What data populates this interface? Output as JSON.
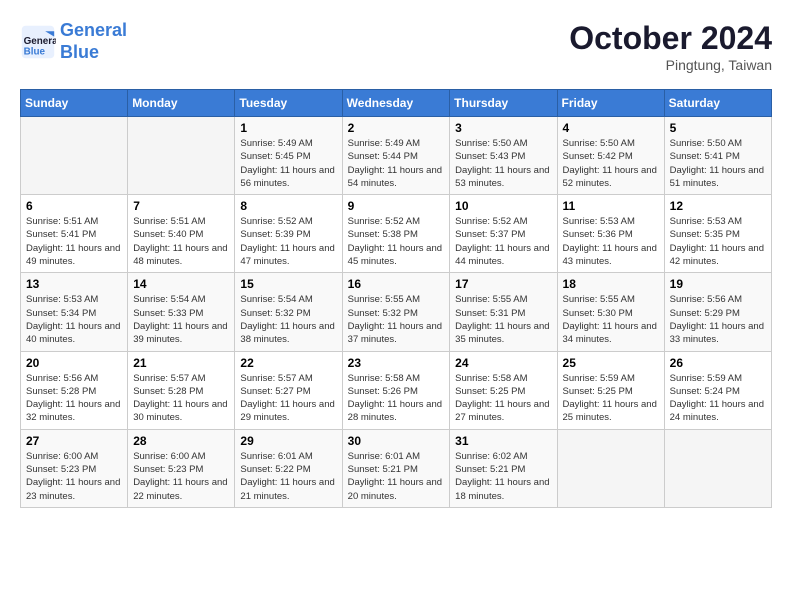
{
  "header": {
    "logo_line1": "General",
    "logo_line2": "Blue",
    "month": "October 2024",
    "location": "Pingtung, Taiwan"
  },
  "weekdays": [
    "Sunday",
    "Monday",
    "Tuesday",
    "Wednesday",
    "Thursday",
    "Friday",
    "Saturday"
  ],
  "weeks": [
    [
      {
        "day": "",
        "sunrise": "",
        "sunset": "",
        "daylight": ""
      },
      {
        "day": "",
        "sunrise": "",
        "sunset": "",
        "daylight": ""
      },
      {
        "day": "1",
        "sunrise": "Sunrise: 5:49 AM",
        "sunset": "Sunset: 5:45 PM",
        "daylight": "Daylight: 11 hours and 56 minutes."
      },
      {
        "day": "2",
        "sunrise": "Sunrise: 5:49 AM",
        "sunset": "Sunset: 5:44 PM",
        "daylight": "Daylight: 11 hours and 54 minutes."
      },
      {
        "day": "3",
        "sunrise": "Sunrise: 5:50 AM",
        "sunset": "Sunset: 5:43 PM",
        "daylight": "Daylight: 11 hours and 53 minutes."
      },
      {
        "day": "4",
        "sunrise": "Sunrise: 5:50 AM",
        "sunset": "Sunset: 5:42 PM",
        "daylight": "Daylight: 11 hours and 52 minutes."
      },
      {
        "day": "5",
        "sunrise": "Sunrise: 5:50 AM",
        "sunset": "Sunset: 5:41 PM",
        "daylight": "Daylight: 11 hours and 51 minutes."
      }
    ],
    [
      {
        "day": "6",
        "sunrise": "Sunrise: 5:51 AM",
        "sunset": "Sunset: 5:41 PM",
        "daylight": "Daylight: 11 hours and 49 minutes."
      },
      {
        "day": "7",
        "sunrise": "Sunrise: 5:51 AM",
        "sunset": "Sunset: 5:40 PM",
        "daylight": "Daylight: 11 hours and 48 minutes."
      },
      {
        "day": "8",
        "sunrise": "Sunrise: 5:52 AM",
        "sunset": "Sunset: 5:39 PM",
        "daylight": "Daylight: 11 hours and 47 minutes."
      },
      {
        "day": "9",
        "sunrise": "Sunrise: 5:52 AM",
        "sunset": "Sunset: 5:38 PM",
        "daylight": "Daylight: 11 hours and 45 minutes."
      },
      {
        "day": "10",
        "sunrise": "Sunrise: 5:52 AM",
        "sunset": "Sunset: 5:37 PM",
        "daylight": "Daylight: 11 hours and 44 minutes."
      },
      {
        "day": "11",
        "sunrise": "Sunrise: 5:53 AM",
        "sunset": "Sunset: 5:36 PM",
        "daylight": "Daylight: 11 hours and 43 minutes."
      },
      {
        "day": "12",
        "sunrise": "Sunrise: 5:53 AM",
        "sunset": "Sunset: 5:35 PM",
        "daylight": "Daylight: 11 hours and 42 minutes."
      }
    ],
    [
      {
        "day": "13",
        "sunrise": "Sunrise: 5:53 AM",
        "sunset": "Sunset: 5:34 PM",
        "daylight": "Daylight: 11 hours and 40 minutes."
      },
      {
        "day": "14",
        "sunrise": "Sunrise: 5:54 AM",
        "sunset": "Sunset: 5:33 PM",
        "daylight": "Daylight: 11 hours and 39 minutes."
      },
      {
        "day": "15",
        "sunrise": "Sunrise: 5:54 AM",
        "sunset": "Sunset: 5:32 PM",
        "daylight": "Daylight: 11 hours and 38 minutes."
      },
      {
        "day": "16",
        "sunrise": "Sunrise: 5:55 AM",
        "sunset": "Sunset: 5:32 PM",
        "daylight": "Daylight: 11 hours and 37 minutes."
      },
      {
        "day": "17",
        "sunrise": "Sunrise: 5:55 AM",
        "sunset": "Sunset: 5:31 PM",
        "daylight": "Daylight: 11 hours and 35 minutes."
      },
      {
        "day": "18",
        "sunrise": "Sunrise: 5:55 AM",
        "sunset": "Sunset: 5:30 PM",
        "daylight": "Daylight: 11 hours and 34 minutes."
      },
      {
        "day": "19",
        "sunrise": "Sunrise: 5:56 AM",
        "sunset": "Sunset: 5:29 PM",
        "daylight": "Daylight: 11 hours and 33 minutes."
      }
    ],
    [
      {
        "day": "20",
        "sunrise": "Sunrise: 5:56 AM",
        "sunset": "Sunset: 5:28 PM",
        "daylight": "Daylight: 11 hours and 32 minutes."
      },
      {
        "day": "21",
        "sunrise": "Sunrise: 5:57 AM",
        "sunset": "Sunset: 5:28 PM",
        "daylight": "Daylight: 11 hours and 30 minutes."
      },
      {
        "day": "22",
        "sunrise": "Sunrise: 5:57 AM",
        "sunset": "Sunset: 5:27 PM",
        "daylight": "Daylight: 11 hours and 29 minutes."
      },
      {
        "day": "23",
        "sunrise": "Sunrise: 5:58 AM",
        "sunset": "Sunset: 5:26 PM",
        "daylight": "Daylight: 11 hours and 28 minutes."
      },
      {
        "day": "24",
        "sunrise": "Sunrise: 5:58 AM",
        "sunset": "Sunset: 5:25 PM",
        "daylight": "Daylight: 11 hours and 27 minutes."
      },
      {
        "day": "25",
        "sunrise": "Sunrise: 5:59 AM",
        "sunset": "Sunset: 5:25 PM",
        "daylight": "Daylight: 11 hours and 25 minutes."
      },
      {
        "day": "26",
        "sunrise": "Sunrise: 5:59 AM",
        "sunset": "Sunset: 5:24 PM",
        "daylight": "Daylight: 11 hours and 24 minutes."
      }
    ],
    [
      {
        "day": "27",
        "sunrise": "Sunrise: 6:00 AM",
        "sunset": "Sunset: 5:23 PM",
        "daylight": "Daylight: 11 hours and 23 minutes."
      },
      {
        "day": "28",
        "sunrise": "Sunrise: 6:00 AM",
        "sunset": "Sunset: 5:23 PM",
        "daylight": "Daylight: 11 hours and 22 minutes."
      },
      {
        "day": "29",
        "sunrise": "Sunrise: 6:01 AM",
        "sunset": "Sunset: 5:22 PM",
        "daylight": "Daylight: 11 hours and 21 minutes."
      },
      {
        "day": "30",
        "sunrise": "Sunrise: 6:01 AM",
        "sunset": "Sunset: 5:21 PM",
        "daylight": "Daylight: 11 hours and 20 minutes."
      },
      {
        "day": "31",
        "sunrise": "Sunrise: 6:02 AM",
        "sunset": "Sunset: 5:21 PM",
        "daylight": "Daylight: 11 hours and 18 minutes."
      },
      {
        "day": "",
        "sunrise": "",
        "sunset": "",
        "daylight": ""
      },
      {
        "day": "",
        "sunrise": "",
        "sunset": "",
        "daylight": ""
      }
    ]
  ]
}
